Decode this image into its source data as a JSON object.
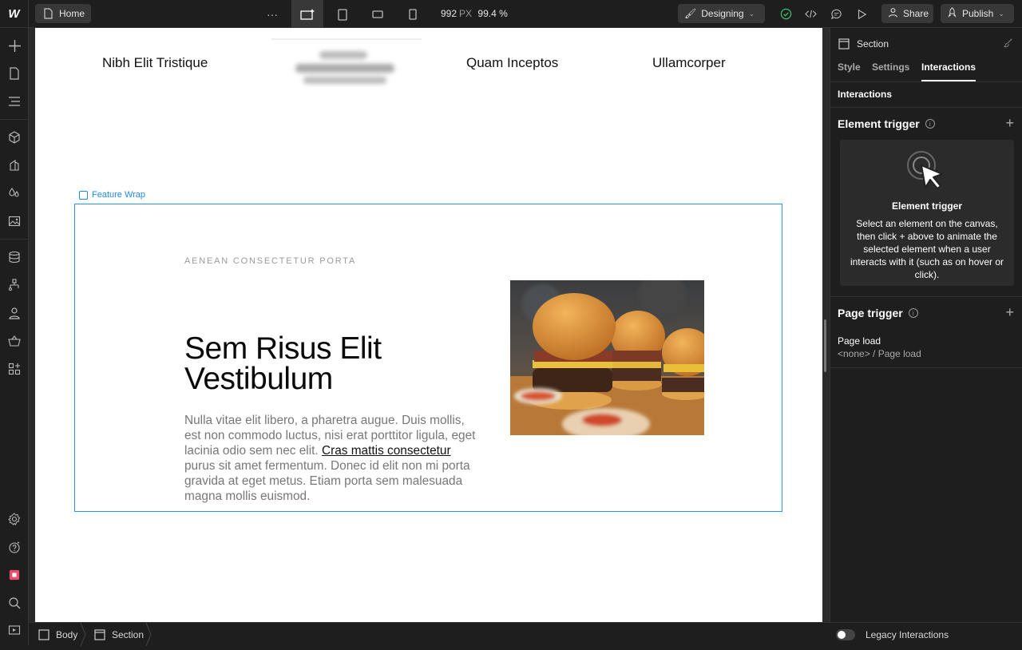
{
  "app": {
    "logo": "W",
    "page_name": "Home",
    "width_value": "992",
    "width_unit": "PX",
    "zoom": "99.4 %",
    "mode_label": "Designing",
    "share_label": "Share",
    "publish_label": "Publish"
  },
  "canvas": {
    "nav_items": [
      "Nibh Elit Tristique",
      "Quam Inceptos",
      "Ullamcorper"
    ],
    "selected_label": "Feature Wrap",
    "eyebrow": "AENEAN CONSECTETUR PORTA",
    "heading": "Sem Risus Elit Vestibulum",
    "paragraph_before": "Nulla vitae elit libero, a pharetra augue. Duis mollis, est non commodo luctus, nisi erat porttitor ligula, eget lacinia odio sem nec elit. ",
    "paragraph_link": "Cras mattis consectetur",
    "paragraph_after": " purus sit amet fermentum. Donec id elit non mi porta gravida at eget metus. Etiam porta sem malesuada magna mollis euismod."
  },
  "panel": {
    "element_type": "Section",
    "tabs": [
      "Style",
      "Settings",
      "Interactions"
    ],
    "active_tab": "Interactions",
    "section_title": "Interactions",
    "element_trigger_title": "Element trigger",
    "card_title": "Element trigger",
    "card_body": "Select an element on the canvas, then click + above to animate the selected element when a user interacts with it (such as on hover or click).",
    "page_trigger_title": "Page trigger",
    "page_load_label": "Page load",
    "page_load_value": "<none> / Page load",
    "legacy_label": "Legacy Interactions"
  },
  "breadcrumbs": [
    "Body",
    "Section"
  ],
  "colors": {
    "selection_blue": "#2196f3",
    "chrome_bg": "#1e1e1e",
    "button_bg": "#383838",
    "status_green": "#3ec46d"
  }
}
